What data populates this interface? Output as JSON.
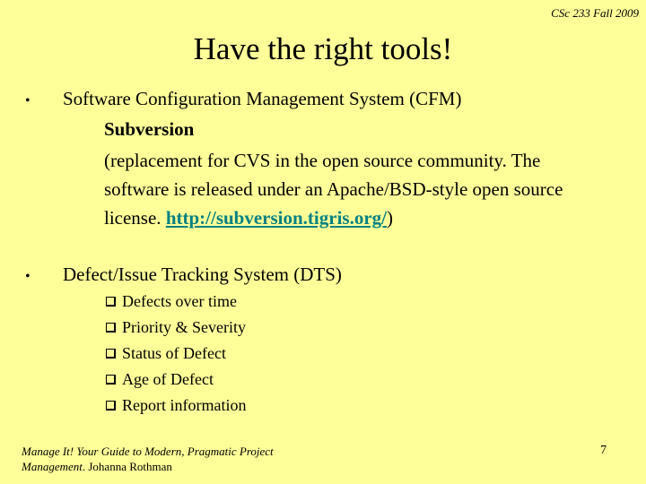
{
  "header": {
    "course_note": "CSc 233 Fall 2009"
  },
  "slide": {
    "title": "Have the right tools!",
    "bullets": [
      {
        "marker": "•",
        "text": "Software Configuration Management System (CFM)",
        "sub_title": "Subversion",
        "sub_desc_prefix": "(replacement for CVS in the open source community. The software is released under an Apache/BSD-style open source license. ",
        "link_text": "http://subversion.tigris.org/",
        "sub_desc_suffix": ")"
      },
      {
        "marker": "•",
        "text": "Defect/Issue Tracking System (DTS)",
        "items": [
          "Defects over time",
          "Priority & Severity",
          "Status of Defect",
          "Age of Defect",
          "Report information"
        ]
      }
    ]
  },
  "footer": {
    "reference_italic": "Manage It! Your Guide to Modern, Pragmatic Project Management",
    "reference_suffix": ". Johanna Rothman",
    "page_number": "7"
  }
}
